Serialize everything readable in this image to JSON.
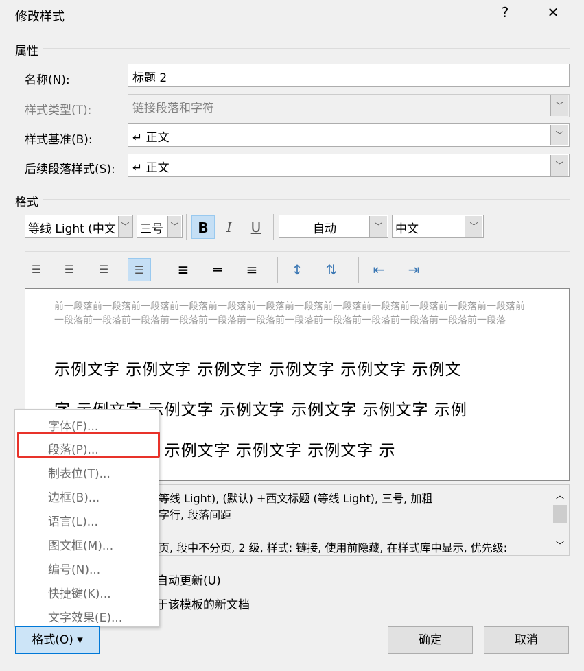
{
  "dialog": {
    "title": "修改样式",
    "help": "?",
    "close": "✕"
  },
  "properties": {
    "header": "属性",
    "name_label": "名称(N):",
    "name_value": "标题 2",
    "type_label": "样式类型(T):",
    "type_value": "链接段落和字符",
    "based_label": "样式基准(B):",
    "based_value": "↵ 正文",
    "next_label": "后续段落样式(S):",
    "next_value": "↵ 正文"
  },
  "format": {
    "header": "格式",
    "font": "等线 Light (中文",
    "size": "三号",
    "bold": "B",
    "italic": "I",
    "underline": "U",
    "color": "自动",
    "script": "中文",
    "bold_active": true,
    "align_justify_active": true
  },
  "preview": {
    "prev_para": "前一段落前一段落前一段落前一段落前一段落前一段落前一段落前一段落前一段落前一段落前一段落前一段落前一段落前一段落前一段落前一段落前一段落前一段落前一段落前一段落前一段落前一段落前一段落前一段落",
    "lines": [
      "示例文字 示例文字 示例文字 示例文字 示例文字 示例文",
      "字 示例文字 示例文字 示例文字 示例文字 示例文字 示例",
      "文字 示例文字 示例文字 示例文字 示例文字 示"
    ]
  },
  "description": [
    "等线 Light), (默认) +西文标题 (等线 Light), 三号, 加粗",
    "字行, 段落间距",
    "",
    "页, 段中不分页, 2 级, 样式: 链接, 使用前隐藏, 在样式库中显示, 优先级:"
  ],
  "options": {
    "auto_update": "自动更新(U)",
    "new_docs": "于该模板的新文档"
  },
  "menu": {
    "items": [
      "字体(F)...",
      "段落(P)...",
      "制表位(T)...",
      "边框(B)...",
      "语言(L)...",
      "图文框(M)...",
      "编号(N)...",
      "快捷键(K)...",
      "文字效果(E)..."
    ],
    "highlighted": "段落(P)..."
  },
  "buttons": {
    "format": "格式(O) ▾",
    "ok": "确定",
    "cancel": "取消"
  }
}
